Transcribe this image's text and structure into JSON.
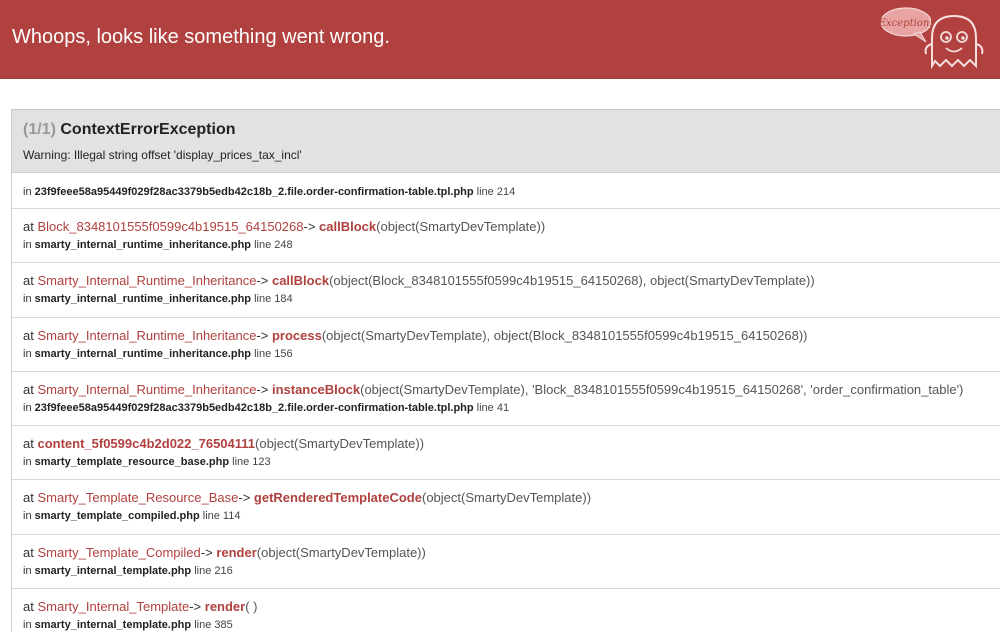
{
  "header": {
    "title": "Whoops, looks like something went wrong.",
    "badge_text": "Exception!",
    "background_color": "#b0413e"
  },
  "exception": {
    "count": "(1/1)",
    "name": "ContextErrorException",
    "message": "Warning: Illegal string offset 'display_prices_tax_incl'"
  },
  "trace": [
    {
      "at": "",
      "class": "",
      "arrow": "",
      "function": "",
      "args": "",
      "in_label": "in",
      "file": "23f9feee58a95449f029f28ac3379b5edb42c18b_2.file.order-confirmation-table.tpl.php",
      "line": "line 214"
    },
    {
      "at": "at",
      "class": "Block_8348101555f0599c4b19515_64150268",
      "arrow": "->",
      "function": "callBlock",
      "args": "(object(SmartyDevTemplate))",
      "in_label": "in",
      "file": "smarty_internal_runtime_inheritance.php",
      "line": "line 248"
    },
    {
      "at": "at",
      "class": "Smarty_Internal_Runtime_Inheritance",
      "arrow": "->",
      "function": "callBlock",
      "args": "(object(Block_8348101555f0599c4b19515_64150268), object(SmartyDevTemplate))",
      "in_label": "in",
      "file": "smarty_internal_runtime_inheritance.php",
      "line": "line 184"
    },
    {
      "at": "at",
      "class": "Smarty_Internal_Runtime_Inheritance",
      "arrow": "->",
      "function": "process",
      "args": "(object(SmartyDevTemplate), object(Block_8348101555f0599c4b19515_64150268))",
      "in_label": "in",
      "file": "smarty_internal_runtime_inheritance.php",
      "line": "line 156"
    },
    {
      "at": "at",
      "class": "Smarty_Internal_Runtime_Inheritance",
      "arrow": "->",
      "function": "instanceBlock",
      "args": "(object(SmartyDevTemplate), 'Block_8348101555f0599c4b19515_64150268', 'order_confirmation_table')",
      "in_label": "in",
      "file": "23f9feee58a95449f029f28ac3379b5edb42c18b_2.file.order-confirmation-table.tpl.php",
      "line": "line 41"
    },
    {
      "at": "at",
      "class": "",
      "arrow": "",
      "function": "content_5f0599c4b2d022_76504111",
      "args": "(object(SmartyDevTemplate))",
      "in_label": "in",
      "file": "smarty_template_resource_base.php",
      "line": "line 123"
    },
    {
      "at": "at",
      "class": "Smarty_Template_Resource_Base",
      "arrow": "->",
      "function": "getRenderedTemplateCode",
      "args": "(object(SmartyDevTemplate))",
      "in_label": "in",
      "file": "smarty_template_compiled.php",
      "line": "line 114"
    },
    {
      "at": "at",
      "class": "Smarty_Template_Compiled",
      "arrow": "->",
      "function": "render",
      "args": "(object(SmartyDevTemplate))",
      "in_label": "in",
      "file": "smarty_internal_template.php",
      "line": "line 216"
    },
    {
      "at": "at",
      "class": "Smarty_Internal_Template",
      "arrow": "->",
      "function": "render",
      "args": "( )",
      "in_label": "in",
      "file": "smarty_internal_template.php",
      "line": "line 385"
    }
  ]
}
